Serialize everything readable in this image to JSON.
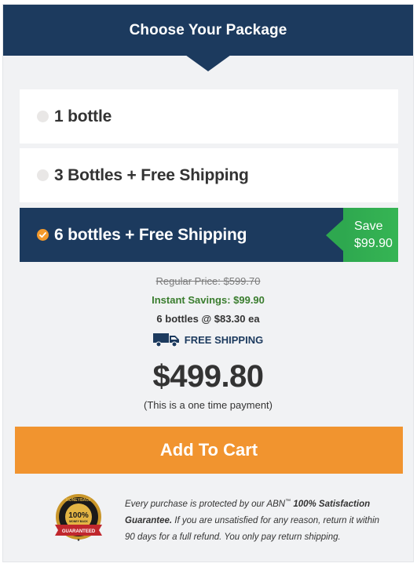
{
  "header": {
    "title": "Choose Your Package"
  },
  "options": [
    {
      "label": "1 bottle",
      "selected": false
    },
    {
      "label": "3 Bottles + Free Shipping",
      "selected": false
    },
    {
      "label": "6 bottles + Free Shipping",
      "selected": true,
      "badge": {
        "line1": "Save",
        "line2": "$99.90"
      }
    }
  ],
  "pricing": {
    "regular": "Regular Price: $599.70",
    "savings": "Instant Savings: $99.90",
    "per_unit": "6 bottles @ $83.30 ea",
    "shipping": "FREE SHIPPING",
    "total": "$499.80",
    "note": "(This is a one time payment)"
  },
  "cart_button": {
    "label": "Add To Cart"
  },
  "guarantee": {
    "text_before": "Every purchase is protected by our ABN",
    "trademark": "™",
    "bold_text": "100% Satisfaction Guarantee.",
    "text_after": "If you are unsatisfied for any reason, return it within 90 days for a full refund. You only pay return shipping.",
    "seal": {
      "top": "MONEYBACK",
      "middle": "100%",
      "small": "MONEY BACK",
      "ribbon": "GUARANTEED"
    }
  },
  "colors": {
    "navy": "#1c3a5e",
    "orange": "#f1942f",
    "green": "#2ea84f",
    "savings_green": "#3a7d2e",
    "background": "#f1f2f4"
  },
  "icons": {
    "selected_radio": "check-circle-icon",
    "shipping": "delivery-truck-icon",
    "seal": "guarantee-seal-icon"
  }
}
